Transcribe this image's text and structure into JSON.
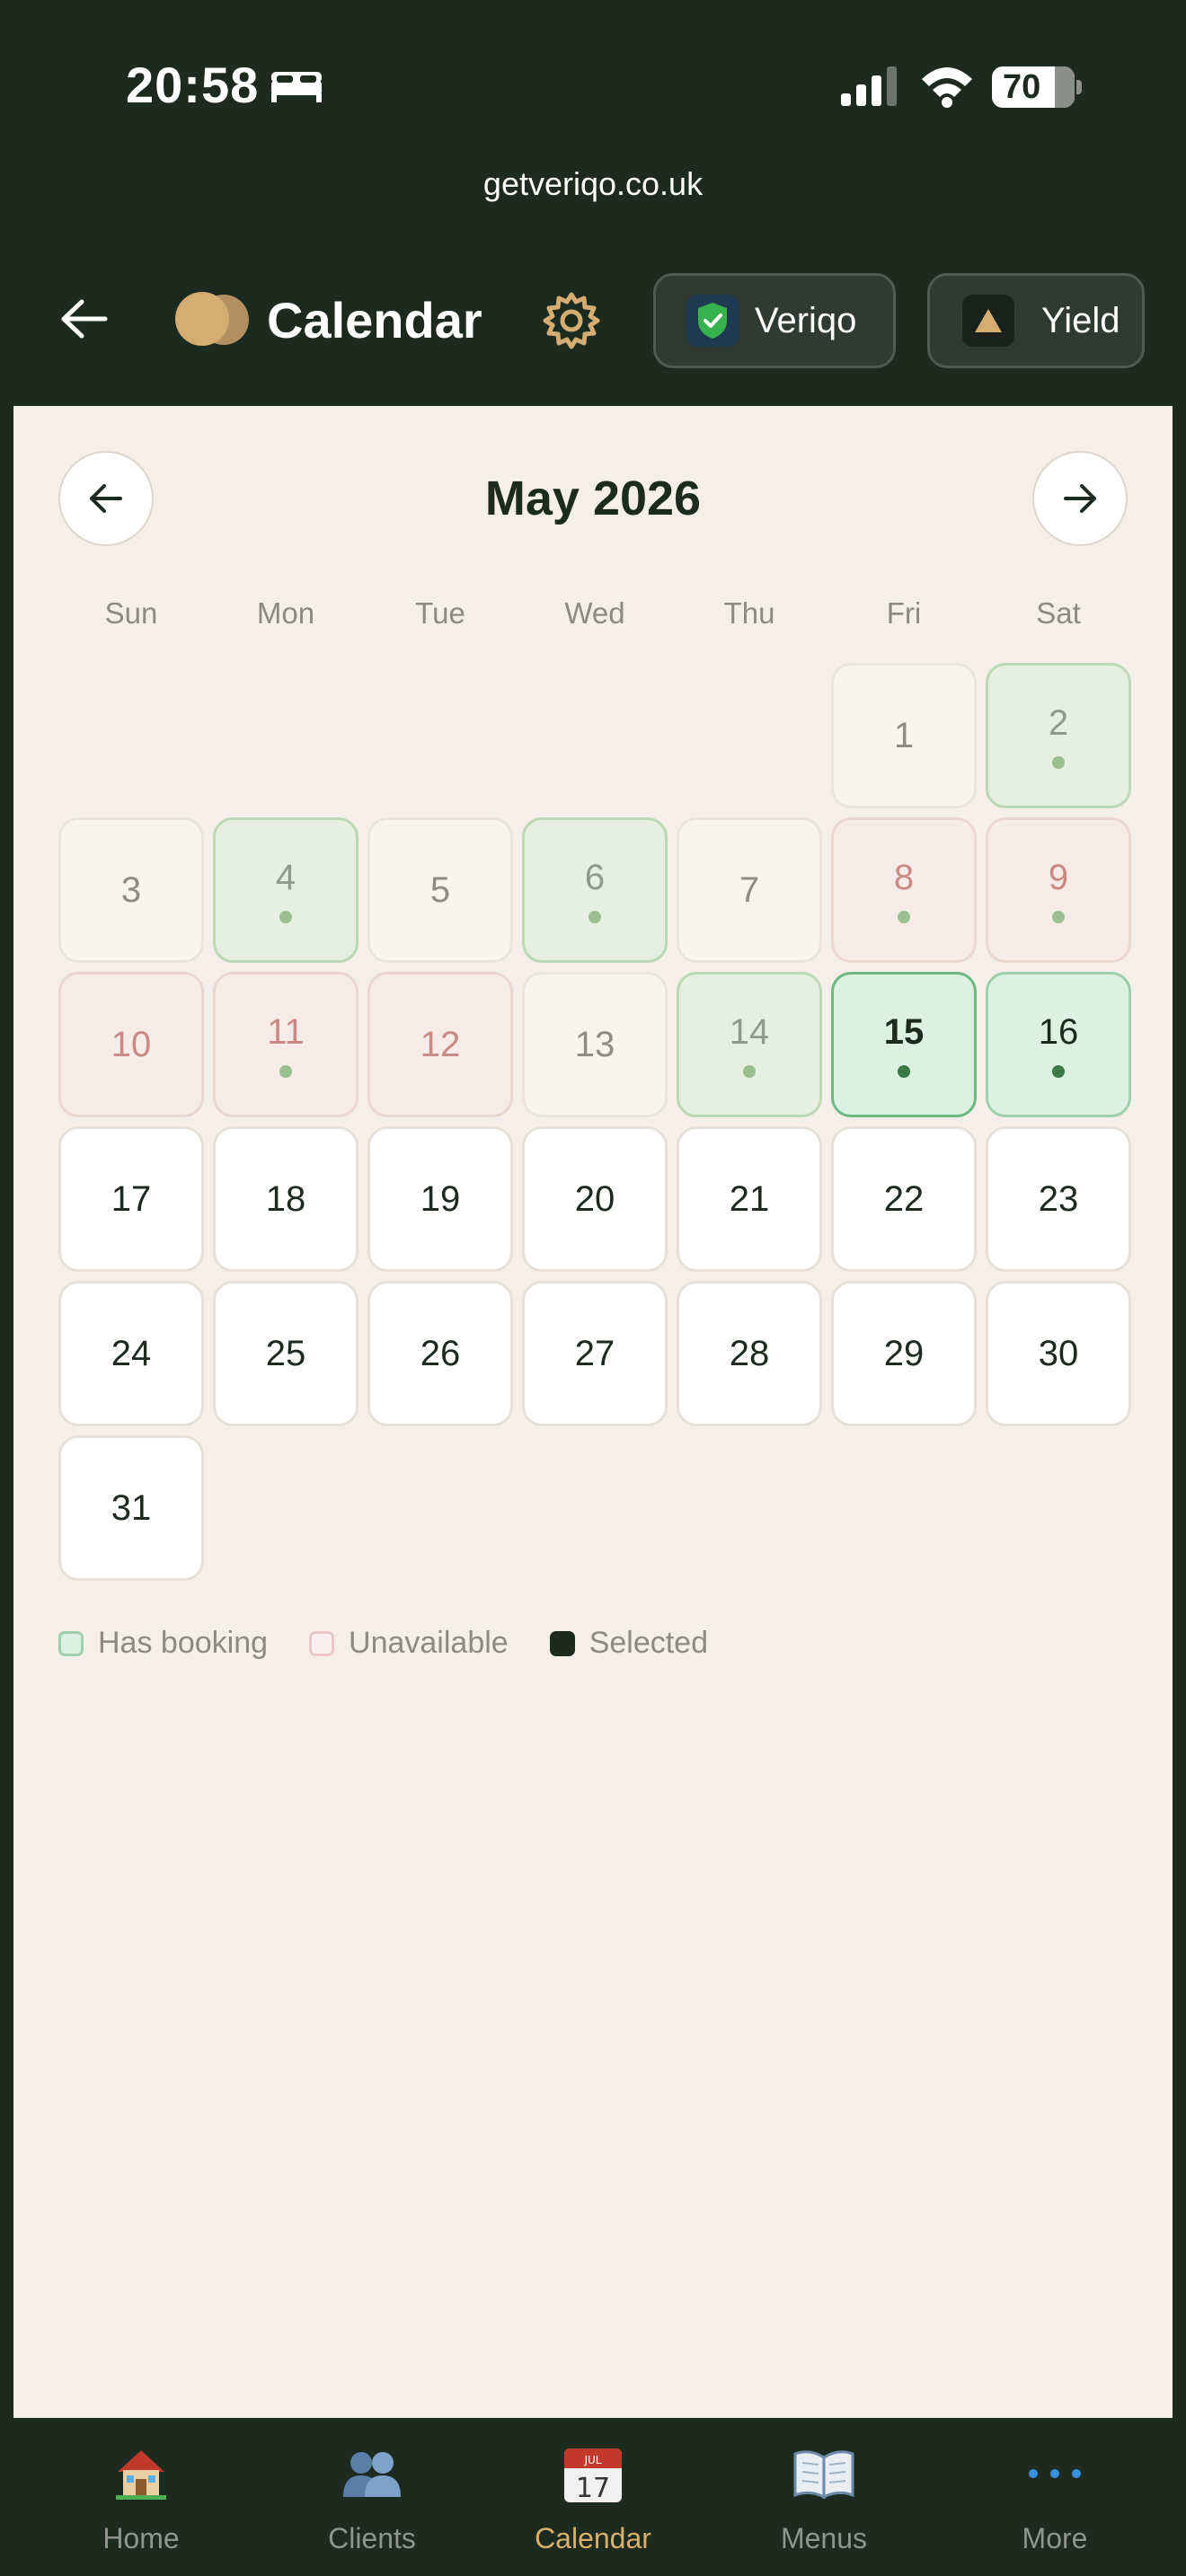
{
  "status_bar": {
    "time": "20:58",
    "battery": "70"
  },
  "browser": {
    "url": "getveriqo.co.uk"
  },
  "header": {
    "title": "Calendar",
    "veriqo_label": "Veriqo",
    "yield_label": "Yield"
  },
  "calendar": {
    "month_label": "May 2026",
    "weekdays": [
      "Sun",
      "Mon",
      "Tue",
      "Wed",
      "Thu",
      "Fri",
      "Sat"
    ],
    "days": [
      {
        "n": "1",
        "state": "past",
        "dot": false
      },
      {
        "n": "2",
        "state": "booked",
        "dot": true
      },
      {
        "n": "3",
        "state": "past",
        "dot": false
      },
      {
        "n": "4",
        "state": "booked",
        "dot": true
      },
      {
        "n": "5",
        "state": "past",
        "dot": false
      },
      {
        "n": "6",
        "state": "booked",
        "dot": true
      },
      {
        "n": "7",
        "state": "past",
        "dot": false
      },
      {
        "n": "8",
        "state": "unavailable",
        "dot": true
      },
      {
        "n": "9",
        "state": "unavailable",
        "dot": true
      },
      {
        "n": "10",
        "state": "unavailable",
        "dot": false
      },
      {
        "n": "11",
        "state": "unavailable",
        "dot": true
      },
      {
        "n": "12",
        "state": "unavailable",
        "dot": false
      },
      {
        "n": "13",
        "state": "past",
        "dot": false
      },
      {
        "n": "14",
        "state": "booked",
        "dot": true
      },
      {
        "n": "15",
        "state": "selected",
        "dot": true
      },
      {
        "n": "16",
        "state": "active",
        "dot": true
      },
      {
        "n": "17",
        "state": "future",
        "dot": false
      },
      {
        "n": "18",
        "state": "future",
        "dot": false
      },
      {
        "n": "19",
        "state": "future",
        "dot": false
      },
      {
        "n": "20",
        "state": "future",
        "dot": false
      },
      {
        "n": "21",
        "state": "future",
        "dot": false
      },
      {
        "n": "22",
        "state": "future",
        "dot": false
      },
      {
        "n": "23",
        "state": "future",
        "dot": false
      },
      {
        "n": "24",
        "state": "future",
        "dot": false
      },
      {
        "n": "25",
        "state": "future",
        "dot": false
      },
      {
        "n": "26",
        "state": "future",
        "dot": false
      },
      {
        "n": "27",
        "state": "future",
        "dot": false
      },
      {
        "n": "28",
        "state": "future",
        "dot": false
      },
      {
        "n": "29",
        "state": "future",
        "dot": false
      },
      {
        "n": "30",
        "state": "future",
        "dot": false
      },
      {
        "n": "31",
        "state": "future",
        "dot": false
      }
    ],
    "first_weekday_index": 5
  },
  "legend": {
    "booking": "Has booking",
    "unavailable": "Unavailable",
    "selected": "Selected"
  },
  "bottom_nav": {
    "home": "Home",
    "clients": "Clients",
    "calendar": "Calendar",
    "calendar_icon_month": "JUL",
    "calendar_icon_day": "17",
    "menus": "Menus",
    "more": "More"
  },
  "colors": {
    "dark": "#1d2a20",
    "background": "#f4efe8",
    "accent_gold": "#d9b06a",
    "booked_green": "#ddf1e2",
    "unavailable_pink": "#f6ebe6"
  }
}
